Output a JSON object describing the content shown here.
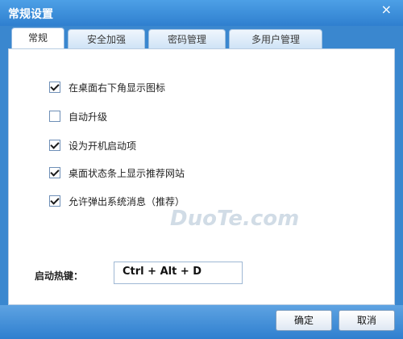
{
  "window": {
    "title": "常规设置",
    "close_symbol": "×"
  },
  "tabs": [
    {
      "label": "常规",
      "active": true
    },
    {
      "label": "安全加强",
      "active": false
    },
    {
      "label": "密码管理",
      "active": false
    },
    {
      "label": "多用户管理",
      "active": false
    }
  ],
  "options": [
    {
      "label": "在桌面右下角显示图标",
      "checked": true
    },
    {
      "label": "自动升级",
      "checked": false
    },
    {
      "label": "设为开机启动项",
      "checked": true
    },
    {
      "label": "桌面状态条上显示推荐网站",
      "checked": true
    },
    {
      "label": "允许弹出系统消息（推荐）",
      "checked": true
    }
  ],
  "hotkey": {
    "label": "启动热键：",
    "value": "Ctrl + Alt + D"
  },
  "buttons": {
    "ok": "确定",
    "cancel": "取消"
  },
  "watermark": "DuoTe.com"
}
